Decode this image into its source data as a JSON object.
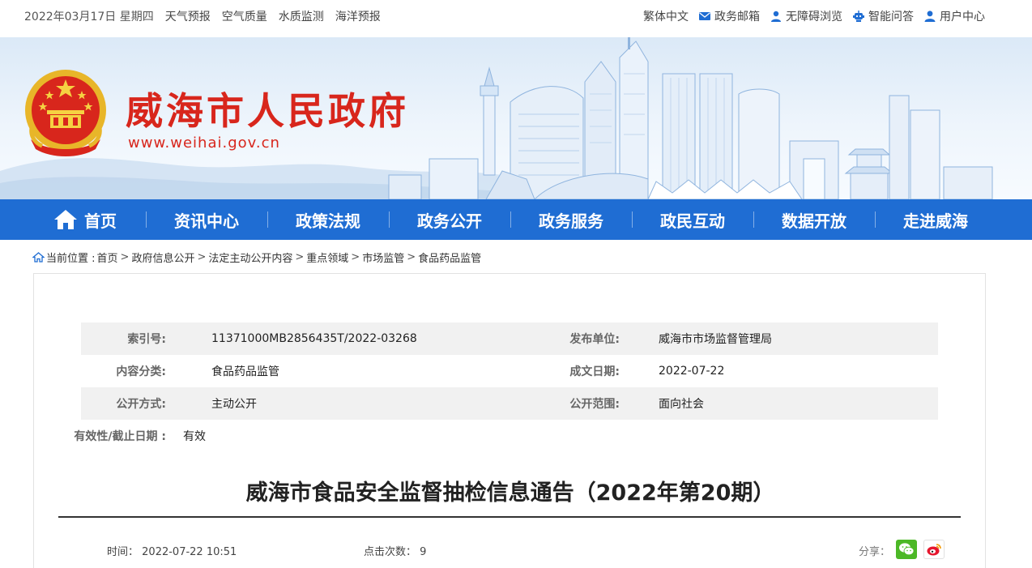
{
  "topbar": {
    "date": "2022年03月17日 星期四",
    "links": [
      "天气预报",
      "空气质量",
      "水质监测",
      "海洋预报"
    ],
    "right": {
      "traditional": "繁体中文",
      "mail": "政务邮箱",
      "accessible": "无障碍浏览",
      "qa": "智能问答",
      "user": "用户中心"
    }
  },
  "banner": {
    "title": "威海市人民政府",
    "url": "www.weihai.gov.cn"
  },
  "nav": {
    "items": [
      "首页",
      "资讯中心",
      "政策法规",
      "政务公开",
      "政务服务",
      "政民互动",
      "数据开放",
      "走进威海"
    ]
  },
  "breadcrumb": {
    "prefix": "当前位置 :",
    "items": [
      "首页",
      "政府信息公开",
      "法定主动公开内容",
      "重点领域",
      "市场监管",
      "食品药品监管"
    ]
  },
  "meta": {
    "index_label": "索引号:",
    "index_value": "11371000MB2856435T/2022-03268",
    "publisher_label": "发布单位:",
    "publisher_value": "威海市市场监督管理局",
    "category_label": "内容分类:",
    "category_value": "食品药品监管",
    "created_label": "成文日期:",
    "created_value": "2022-07-22",
    "mode_label": "公开方式:",
    "mode_value": "主动公开",
    "scope_label": "公开范围:",
    "scope_value": "面向社会",
    "validity_label": "有效性/截止日期 :",
    "validity_value": "有效"
  },
  "article": {
    "title": "威海市食品安全监督抽检信息通告（2022年第20期）",
    "time_label": "时间：",
    "time_value": "2022-07-22 10:51",
    "clicks_label": "点击次数：",
    "clicks_value": "9",
    "share_label": "分享："
  },
  "colors": {
    "nav_blue": "#1f6dd3",
    "title_red": "#d8261c"
  }
}
